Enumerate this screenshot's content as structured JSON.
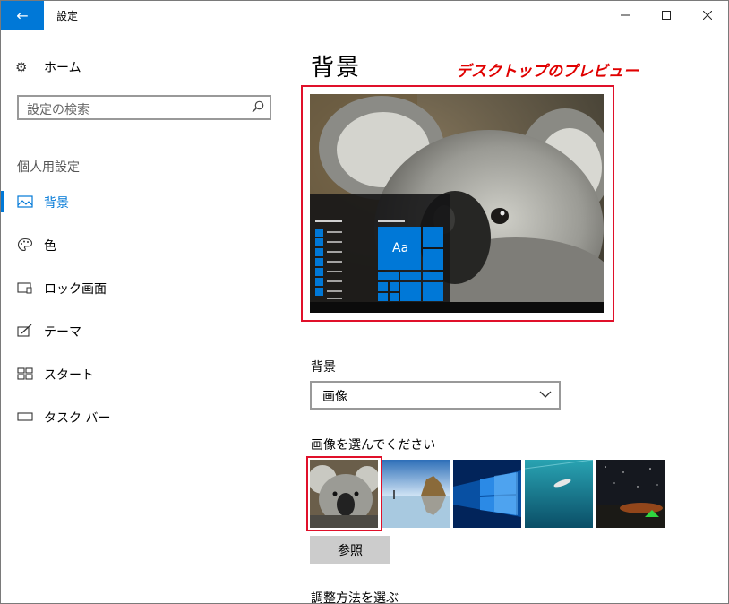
{
  "window": {
    "title": "設定",
    "back_icon": "back-arrow-icon",
    "controls": [
      "minimize-icon",
      "maximize-icon",
      "close-icon"
    ]
  },
  "sidebar": {
    "home_label": "ホーム",
    "search_placeholder": "設定の検索",
    "section_header": "個人用設定",
    "items": [
      {
        "label": "背景",
        "icon": "picture-icon",
        "selected": true
      },
      {
        "label": "色",
        "icon": "palette-icon",
        "selected": false
      },
      {
        "label": "ロック画面",
        "icon": "lock-screen-icon",
        "selected": false
      },
      {
        "label": "テーマ",
        "icon": "theme-icon",
        "selected": false
      },
      {
        "label": "スタート",
        "icon": "start-icon",
        "selected": false
      },
      {
        "label": "タスク バー",
        "icon": "taskbar-icon",
        "selected": false
      }
    ]
  },
  "main": {
    "title": "背景",
    "preview_annotation": "デスクトップのプレビュー",
    "preview_tile_text": "Aa",
    "background_label": "背景",
    "background_value": "画像",
    "choose_picture_label": "画像を選んでください",
    "thumbnails": [
      "koala",
      "beach-rocks",
      "windows-light",
      "underwater-swimmer",
      "starry-tent"
    ],
    "selected_thumbnail": "koala",
    "browse_label": "参照",
    "fit_label": "調整方法を選ぶ"
  },
  "colors": {
    "accent": "#0078d7",
    "annotation": "#e00000"
  }
}
